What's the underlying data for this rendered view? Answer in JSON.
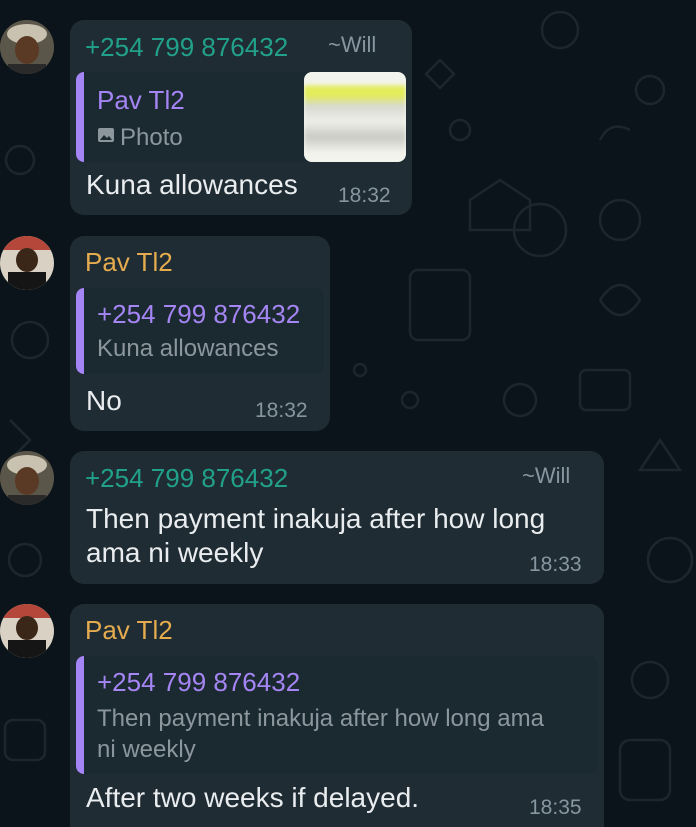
{
  "colors": {
    "background": "#0b141a",
    "bubble": "#202c33",
    "phone_sender": "#21a18a",
    "pav_sender": "#e5ac4f",
    "quote_accent": "#a585f4",
    "timestamp": "#8696a0"
  },
  "messages": [
    {
      "sender": "+254 799 876432",
      "alias": "~Will",
      "quote": {
        "sender": "Pav Tl2",
        "icon": "photo-icon",
        "text": "Photo"
      },
      "text": "Kuna allowances",
      "time": "18:32"
    },
    {
      "sender": "Pav Tl2",
      "quote": {
        "sender": "+254 799 876432",
        "text": "Kuna allowances"
      },
      "text": "No",
      "time": "18:32"
    },
    {
      "sender": "+254 799 876432",
      "alias": "~Will",
      "text_line1": "Then payment inakuja after how long",
      "text_line2": "ama ni weekly",
      "time": "18:33"
    },
    {
      "sender": "Pav Tl2",
      "quote": {
        "sender": "+254 799 876432",
        "text_line1": "Then payment inakuja after how long ama",
        "text_line2": "ni weekly"
      },
      "text": "After two weeks if delayed.",
      "time": "18:35"
    }
  ]
}
